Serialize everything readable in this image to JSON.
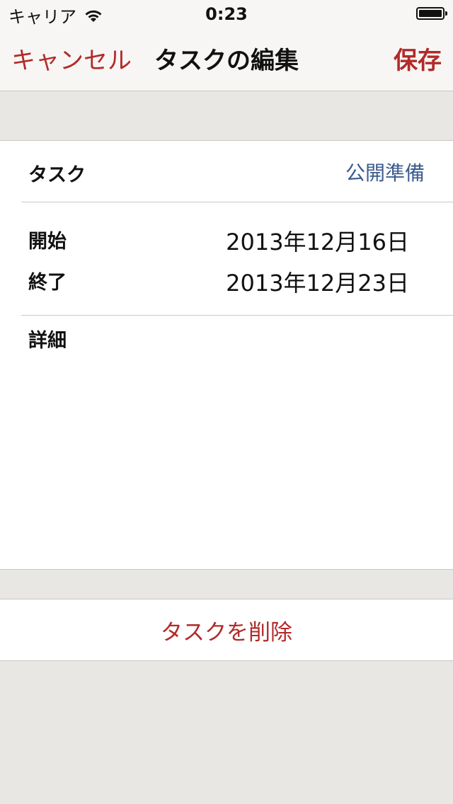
{
  "status_bar": {
    "carrier": "キャリア",
    "time": "0:23",
    "battery_level": 1.0
  },
  "nav": {
    "cancel_label": "キャンセル",
    "title": "タスクの編集",
    "save_label": "保存"
  },
  "form": {
    "task": {
      "label": "タスク",
      "value": "公開準備"
    },
    "start": {
      "label": "開始",
      "value": "2013年12月16日"
    },
    "end": {
      "label": "終了",
      "value": "2013年12月23日"
    },
    "details": {
      "label": "詳細",
      "value": ""
    }
  },
  "delete_button": {
    "label": "タスクを削除"
  },
  "colors": {
    "accent_red": "#b22a2a",
    "value_blue": "#3b5c8f",
    "background": "#e8e7e3"
  },
  "icons": [
    "wifi-icon",
    "battery-icon"
  ]
}
